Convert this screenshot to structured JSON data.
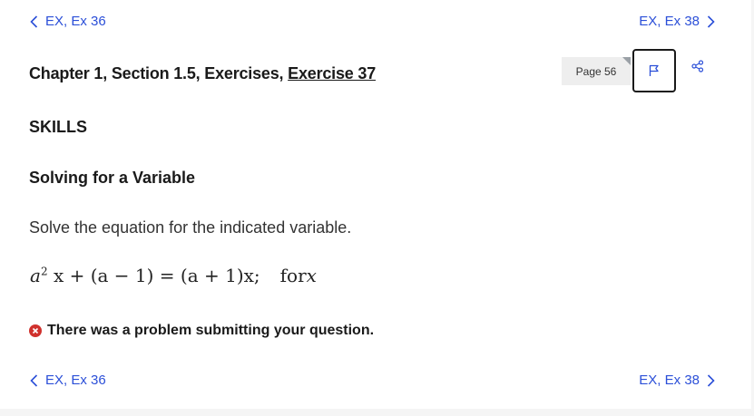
{
  "nav": {
    "prev_label": "EX, Ex 36",
    "next_label": "EX, Ex 38"
  },
  "header": {
    "title_prefix": "Chapter 1, Section 1.5, Exercises, ",
    "title_link": "Exercise 37",
    "page_badge": "Page 56"
  },
  "content": {
    "section": "SKILLS",
    "subsection": "Solving for a Variable",
    "instruction": "Solve the equation for the indicated variable.",
    "equation": {
      "lhs_a": "a",
      "lhs_exp": "2",
      "lhs_rest": "x + (a − 1) = (a + 1)x;",
      "for_word": "for",
      "var": "x"
    }
  },
  "error": {
    "message": "There was a problem submitting your question."
  },
  "colors": {
    "link": "#2b4fd8",
    "error": "#d0312d"
  },
  "icons": {
    "prev": "chevron-left-icon",
    "next": "chevron-right-icon",
    "flag": "flag-icon",
    "share": "share-icon",
    "error": "error-x-icon"
  }
}
